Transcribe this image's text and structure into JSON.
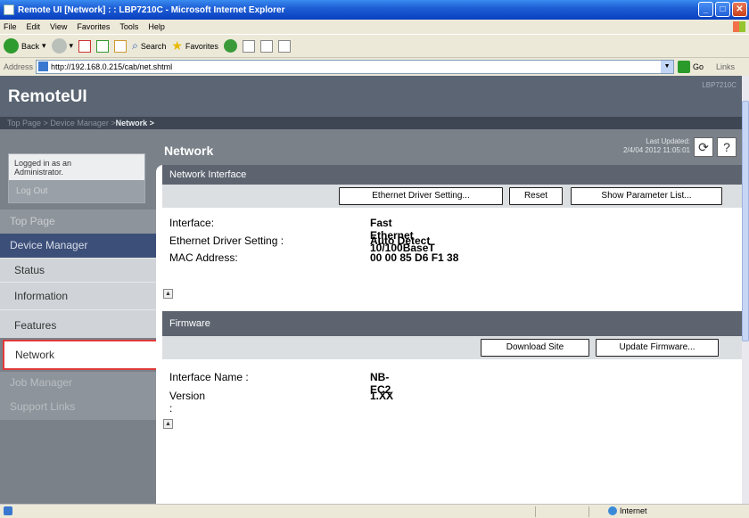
{
  "window": {
    "title": "Remote UI [Network] : : LBP7210C - Microsoft Internet Explorer"
  },
  "menu": [
    "File",
    "Edit",
    "View",
    "Favorites",
    "Tools",
    "Help"
  ],
  "toolbar": {
    "back": "Back",
    "search": "Search",
    "favorites": "Favorites"
  },
  "address": {
    "label": "Address",
    "url": "http://192.168.0.215/cab/net.shtml",
    "go": "Go",
    "links": "Links"
  },
  "brand": {
    "name": "RemoteUI",
    "model": "LBP7210C"
  },
  "breadcrumb": {
    "top": "Top Page >",
    "device": "Device Manager >",
    "current": "Network >"
  },
  "header": {
    "title": "Network",
    "updated_label": "Last Updated:",
    "updated_time": "2/4/04 2012 11:05:01",
    "refresh": "⟳",
    "help": "?"
  },
  "login": {
    "line1": "Logged in as an",
    "line2": "Administrator.",
    "logout": "Log Out"
  },
  "nav": {
    "top_page": "Top Page",
    "device_manager": "Device Manager",
    "status": "Status",
    "information": "Information",
    "features": "Features",
    "network": "Network",
    "job_manager": "Job Manager",
    "support_links": "Support Links"
  },
  "network_interface": {
    "title": "Network Interface",
    "btn_driver": "Ethernet Driver Setting...",
    "btn_reset": "Reset",
    "btn_params": "Show Parameter List...",
    "rows": [
      {
        "label": "Interface:",
        "value": "Fast Ethernet 10/100BaseT"
      },
      {
        "label": "Ethernet Driver Setting :",
        "value": "Auto Detect"
      },
      {
        "label": "MAC Address:",
        "value": "00 00 85 D6 F1 38"
      }
    ]
  },
  "firmware": {
    "title": "Firmware",
    "btn_download": "Download Site",
    "btn_update": "Update Firmware...",
    "rows": [
      {
        "label": "Interface Name :",
        "value": "NB-EC2"
      },
      {
        "label": "Version :",
        "value": "1.XX"
      }
    ]
  },
  "status": {
    "zone": "Internet"
  },
  "colors": {
    "nav_selected": "#3c4f79",
    "highlight": "#e03a3a",
    "section_header": "#5d6470"
  }
}
